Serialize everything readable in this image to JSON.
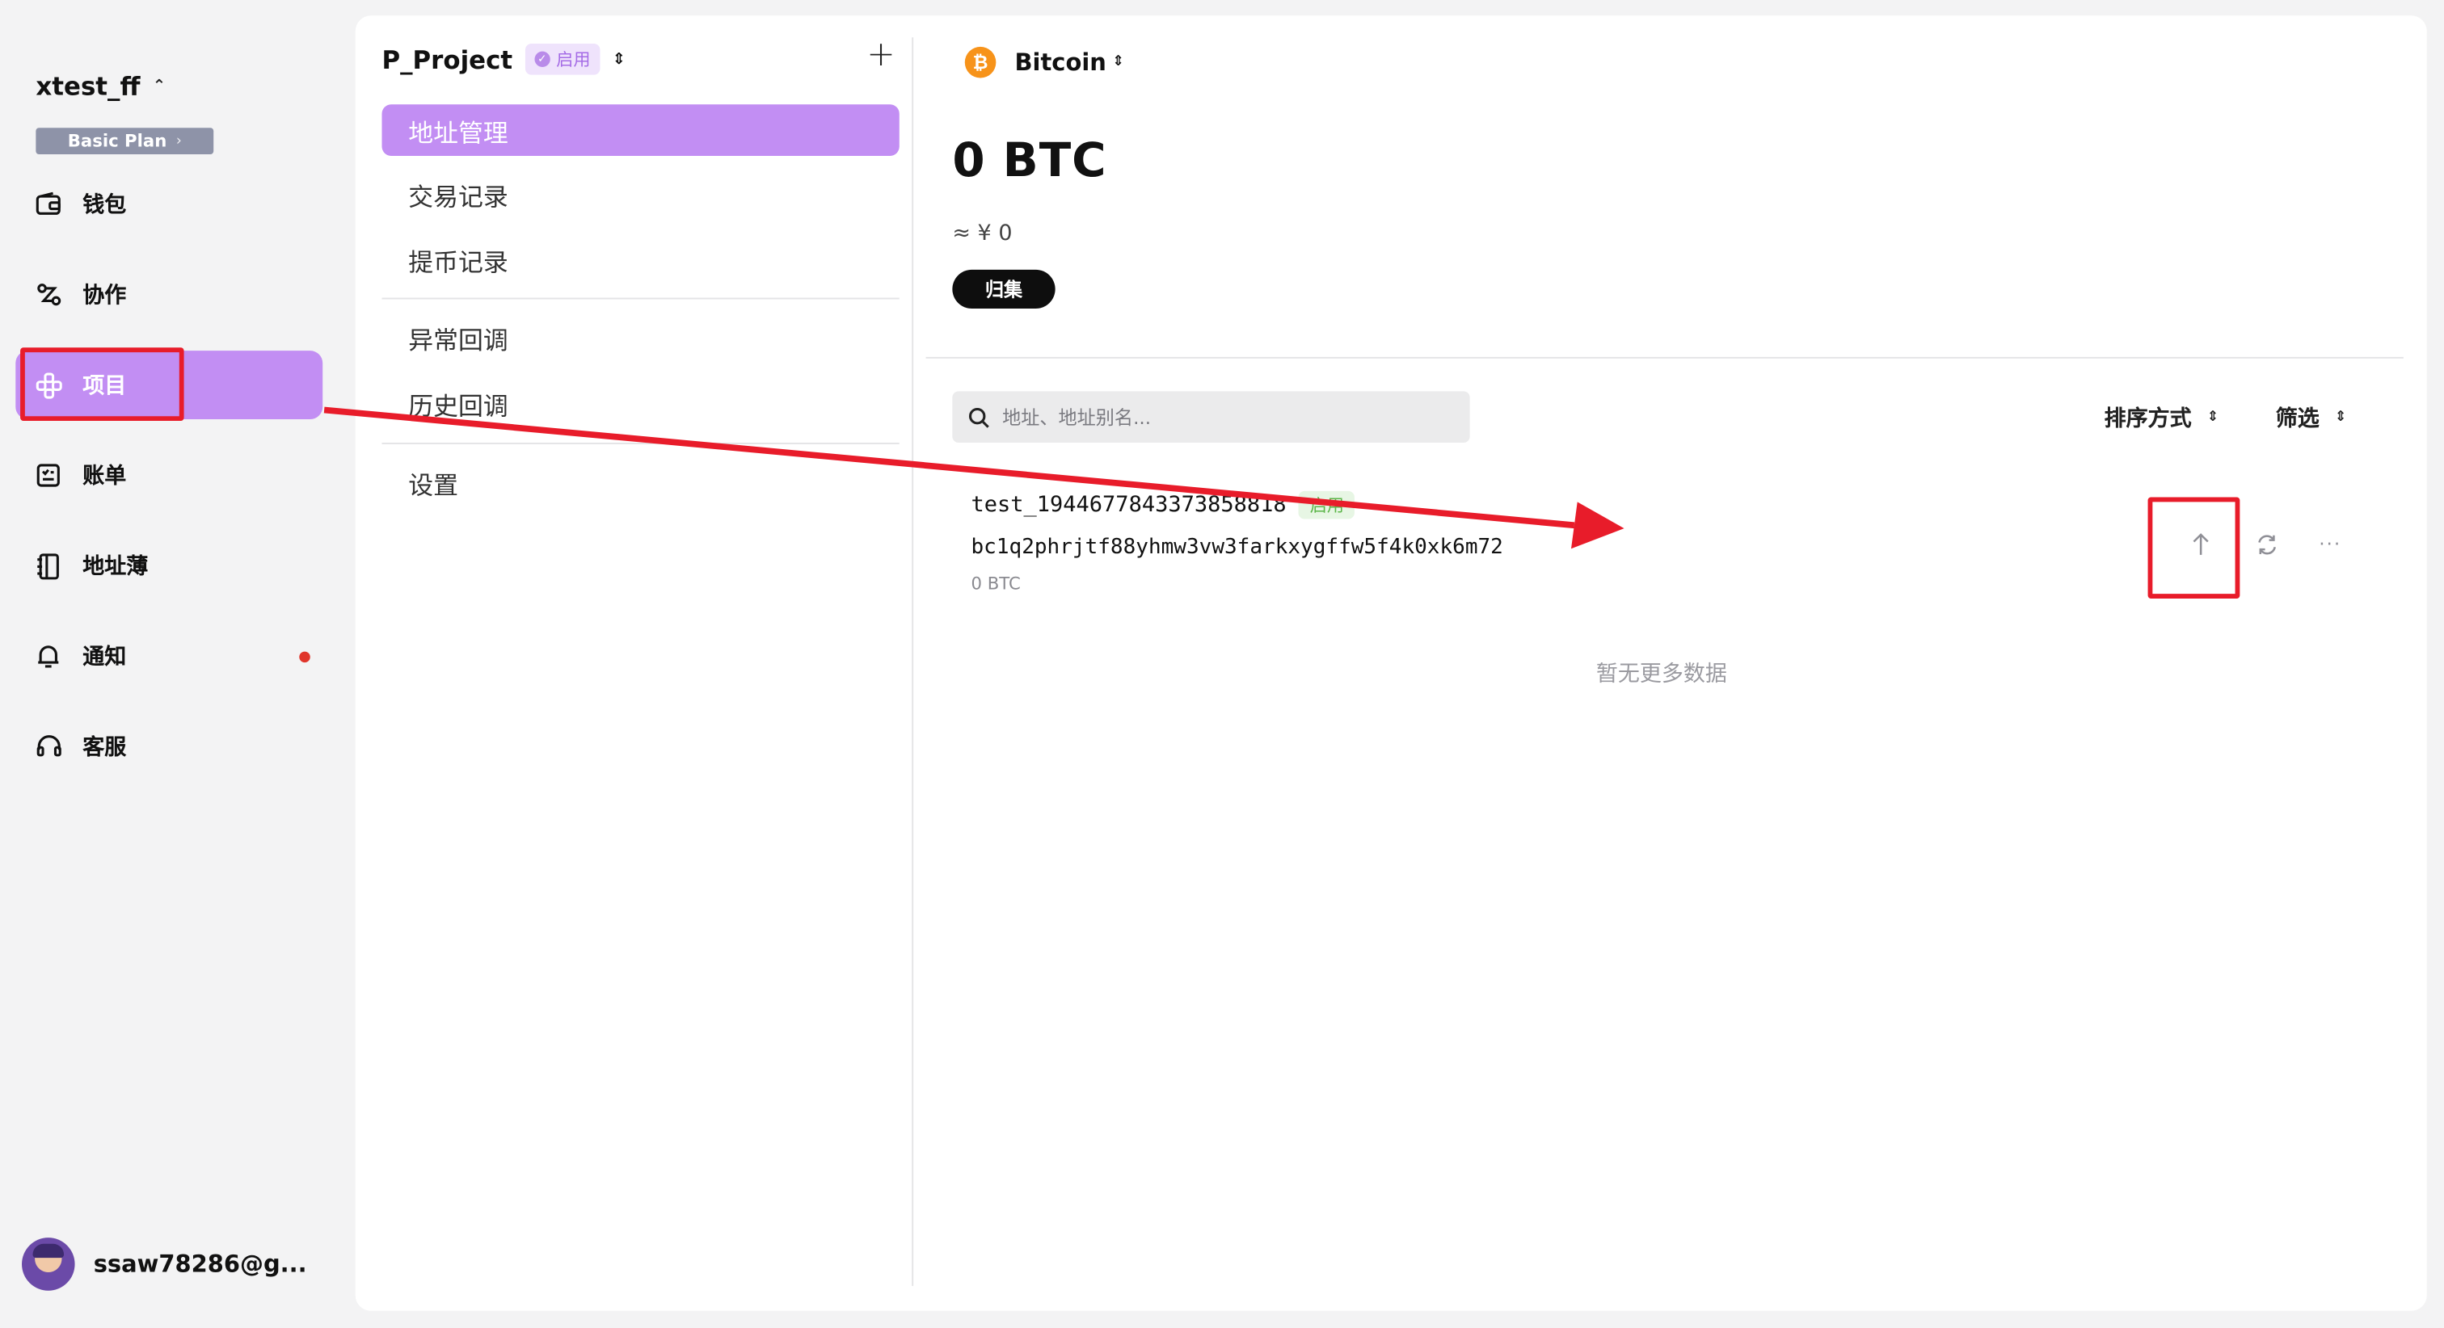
{
  "workspace": {
    "name": "xtest_ff",
    "plan_label": "Basic Plan"
  },
  "sidebar": {
    "items": [
      {
        "label": "钱包",
        "icon": "wallet-icon"
      },
      {
        "label": "协作",
        "icon": "collaboration-icon"
      },
      {
        "label": "项目",
        "icon": "project-icon",
        "active": true
      },
      {
        "label": "账单",
        "icon": "bill-icon"
      },
      {
        "label": "地址薄",
        "icon": "address-book-icon"
      },
      {
        "label": "通知",
        "icon": "bell-icon",
        "has_unread_dot": true
      },
      {
        "label": "客服",
        "icon": "headset-icon"
      }
    ],
    "user": {
      "email": "ssaw78286@g..."
    }
  },
  "project": {
    "name": "P_Project",
    "status": "启用",
    "menu": [
      {
        "label": "地址管理",
        "active": true
      },
      {
        "label": "交易记录"
      },
      {
        "label": "提币记录"
      },
      {
        "label": "异常回调"
      },
      {
        "label": "历史回调"
      },
      {
        "label": "设置"
      }
    ]
  },
  "wallet": {
    "coin_name": "Bitcoin",
    "coin_symbol": "₿",
    "balance": "0 BTC",
    "fiat": "≈ ¥ 0",
    "collect_label": "归集"
  },
  "list": {
    "search_placeholder": "地址、地址别名...",
    "sort_label": "排序方式",
    "filter_label": "筛选",
    "rows": [
      {
        "name": "test_1944677843373858818",
        "status": "启用",
        "address": "bc1q2phrjtf88yhmw3vw3farkxygffw5f4k0xk6m72",
        "balance": "0 BTC"
      }
    ],
    "empty_text": "暂无更多数据"
  },
  "colors": {
    "accent": "#c28ef3",
    "annotation": "#e81c2a",
    "bitcoin": "#f7931a",
    "enabled_green": "#5bb548"
  }
}
